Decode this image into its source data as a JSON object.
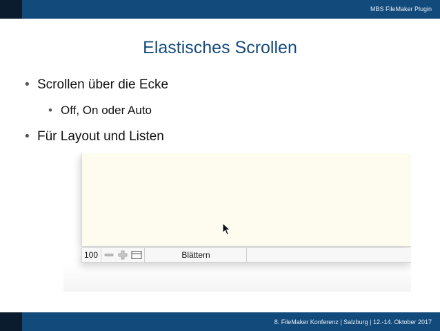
{
  "header": {
    "brand": "MBS FileMaker Plugin"
  },
  "slide": {
    "title": "Elastisches Scrollen",
    "bullets": [
      {
        "text": "Scrollen über die Ecke",
        "level": 1
      },
      {
        "text": "Off, On oder Auto",
        "level": 2
      },
      {
        "text": "Für Layout und Listen",
        "level": 1
      }
    ],
    "bullet_char": "•"
  },
  "screenshot": {
    "zoom_value": "100",
    "mode_label": "Blättern",
    "icons": [
      "zoom-out-icon",
      "zoom-in-icon",
      "layout-toggle-icon",
      "mouse-pointer-icon"
    ]
  },
  "footer": {
    "text": "8. FileMaker Konferenz | Salzburg |  12.-14. Oktober 2017"
  },
  "colors": {
    "accent": "#134a7c",
    "content_bg": "#fdfcef"
  }
}
